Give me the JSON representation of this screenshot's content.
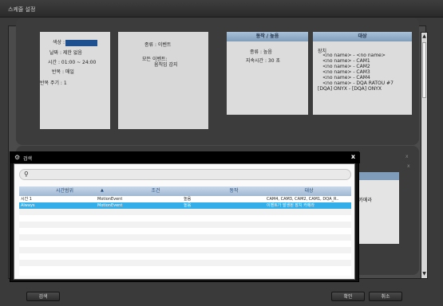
{
  "window": {
    "title": "스케줄 설정"
  },
  "rule_card": {
    "color_label": "색상 :",
    "color_value": "#1e4f8e",
    "day_label": "날짜 : 제한 없음",
    "time_label": "시간 : 01:00 ~ 24:00",
    "repeat_label": "반복 : 매일",
    "repeat_period_label": "반복 주기 : 1"
  },
  "event_card": {
    "type_label": "종류 : 이벤트",
    "all_events_label": "모든 이벤트:",
    "motion_label": "움직임 감지"
  },
  "action_card": {
    "header": "동작 / 높음",
    "type_label": "종류 : 높음",
    "duration_label": "지속시간 : 30 초"
  },
  "target_card": {
    "header": "대상",
    "device_label": "장치",
    "items": [
      "<no name> - <no name>",
      "<no name> - CAM1",
      "<no name> - CAM2",
      "<no name> - CAM3",
      "<no name> - CAM4",
      "<no name> - DQA RATOU #7",
      "[DQA] ONYX - [DQA] ONYX"
    ]
  },
  "lower_panel": {
    "camera_text": "인 카메라"
  },
  "search_dialog": {
    "title": "검색",
    "close_label": "x",
    "search_placeholder": "",
    "columns": [
      "시간범위",
      "조건",
      "동작",
      "대상"
    ],
    "rows": [
      {
        "time_range": "시간 1",
        "condition": "MotionEvent",
        "action": "높음",
        "target": "CAM4, CAM3, CAM2, CAM1, DQA_R..",
        "selected": false
      },
      {
        "time_range": "Always",
        "condition": "MotionEvent",
        "action": "높음",
        "target": "이벤트가 발생된 장치 카메라",
        "selected": true
      }
    ]
  },
  "buttons": {
    "search": "검색",
    "confirm": "확인",
    "cancel": "취소"
  },
  "colors": {
    "header_blue": "#9fb8d3",
    "selected_row": "#34aee8",
    "dark_bg": "#3a3a3a"
  }
}
